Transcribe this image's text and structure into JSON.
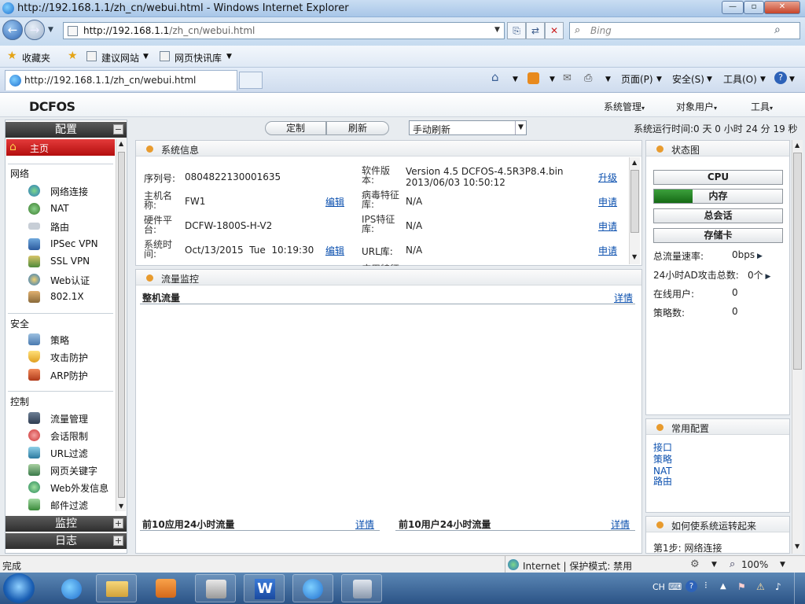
{
  "window": {
    "title": "http://192.168.1.1/zh_cn/webui.html - Windows Internet Explorer",
    "buttons": [
      "—",
      "▫",
      "✕"
    ]
  },
  "browser": {
    "address_host": "http://192.168.1.1",
    "address_path": "/zh_cn/webui.html",
    "search_placeholder": "Bing",
    "favorites": "收藏夹",
    "suggested_sites": "建议网站",
    "web_slice": "网页快讯库",
    "tab_title": "http://192.168.1.1/zh_cn/webui.html",
    "cmd_page": "页面(P)",
    "cmd_safety": "安全(S)",
    "cmd_tools": "工具(O)",
    "status_left": "完成",
    "status_zone": "Internet | 保护模式: 禁用",
    "zoom": "100%"
  },
  "app": {
    "logo": "DCFOS",
    "menu": [
      "系统管理",
      "对象用户",
      "工具"
    ],
    "toolbar": {
      "customize": "定制",
      "refresh": "刷新",
      "refresh_mode": "手动刷新",
      "uptime": "系统运行时间:0 天 0 小时 24 分 19 秒"
    },
    "sidebar": {
      "config_title": "配置",
      "monitor_title": "监控",
      "log_title": "日志",
      "home": "主页",
      "groups": [
        {
          "label": "网络",
          "items": [
            "网络连接",
            "NAT",
            "路由",
            "IPSec VPN",
            "SSL VPN",
            "Web认证",
            "802.1X"
          ]
        },
        {
          "label": "安全",
          "items": [
            "策略",
            "攻击防护",
            "ARP防护"
          ]
        },
        {
          "label": "控制",
          "items": [
            "流量管理",
            "会话限制",
            "URL过滤",
            "网页关键字",
            "Web外发信息",
            "邮件过滤"
          ]
        }
      ]
    },
    "sysinfo": {
      "title": "系统信息",
      "serial_label": "序列号:",
      "serial": "0804822130001635",
      "hostname_label_1": "主机名",
      "hostname_label_2": "称:",
      "hostname": "FW1",
      "platform_label_1": "硬件平",
      "platform_label_2": "台:",
      "platform": "DCFW-1800S-H-V2",
      "systime_label_1": "系统时",
      "systime_label_2": "间:",
      "systime": "Oct/13/2015  Tue  10:19:30",
      "edit": "编辑",
      "sw_label_1": "软件版",
      "sw_label_2": "本:",
      "sw_version": "Version 4.5 DCFOS-4.5R3P8.4.bin",
      "sw_date": "2013/06/03 10:50:12",
      "upgrade": "升级",
      "av_label_1": "病毒特征",
      "av_label_2": "库:",
      "av_value": "N/A",
      "ips_label_1": "IPS特征",
      "ips_label_2": "库:",
      "ips_value": "N/A",
      "url_label": "URL库:",
      "url_value": "N/A",
      "app_label_partial": "应用特征",
      "apply": "申请"
    },
    "traffic": {
      "title": "流量监控",
      "total": "整机流量",
      "detail": "详情",
      "top_apps": "前10应用24小时流量",
      "top_users": "前10用户24小时流量"
    },
    "status": {
      "title": "状态图",
      "cpu": "CPU",
      "memory": "内存",
      "memory_usage_fraction": 0.3,
      "sessions": "总会话",
      "storage": "存储卡",
      "rows": [
        {
          "label": "总流量速率:",
          "value": "0bps",
          "arrow": true
        },
        {
          "label": "24小时AD攻击总数:",
          "value": "0个",
          "arrow": true
        },
        {
          "label": "在线用户:",
          "value": "0",
          "arrow": false
        },
        {
          "label": "策略数:",
          "value": "0",
          "arrow": false
        }
      ]
    },
    "common": {
      "title": "常用配置",
      "links": [
        "接口",
        "策略",
        "NAT",
        "路由"
      ]
    },
    "howto": {
      "title": "如何使系统运转起来",
      "step1": "第1步: 网络连接"
    },
    "colors": {
      "accent_red": "#c91414",
      "memory_bar": "#1a7a1a",
      "panel_dot": "#e89b2e"
    }
  },
  "taskbar": {
    "lang": "CH"
  }
}
